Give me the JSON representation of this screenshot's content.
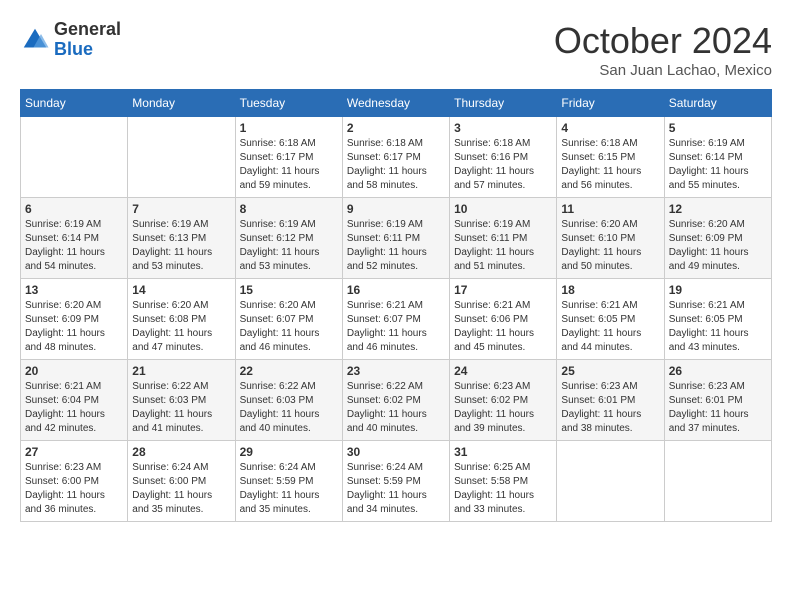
{
  "logo": {
    "general": "General",
    "blue": "Blue"
  },
  "title": "October 2024",
  "location": "San Juan Lachao, Mexico",
  "days_of_week": [
    "Sunday",
    "Monday",
    "Tuesday",
    "Wednesday",
    "Thursday",
    "Friday",
    "Saturday"
  ],
  "weeks": [
    [
      {
        "day": "",
        "info": ""
      },
      {
        "day": "",
        "info": ""
      },
      {
        "day": "1",
        "info": "Sunrise: 6:18 AM\nSunset: 6:17 PM\nDaylight: 11 hours and 59 minutes."
      },
      {
        "day": "2",
        "info": "Sunrise: 6:18 AM\nSunset: 6:17 PM\nDaylight: 11 hours and 58 minutes."
      },
      {
        "day": "3",
        "info": "Sunrise: 6:18 AM\nSunset: 6:16 PM\nDaylight: 11 hours and 57 minutes."
      },
      {
        "day": "4",
        "info": "Sunrise: 6:18 AM\nSunset: 6:15 PM\nDaylight: 11 hours and 56 minutes."
      },
      {
        "day": "5",
        "info": "Sunrise: 6:19 AM\nSunset: 6:14 PM\nDaylight: 11 hours and 55 minutes."
      }
    ],
    [
      {
        "day": "6",
        "info": "Sunrise: 6:19 AM\nSunset: 6:14 PM\nDaylight: 11 hours and 54 minutes."
      },
      {
        "day": "7",
        "info": "Sunrise: 6:19 AM\nSunset: 6:13 PM\nDaylight: 11 hours and 53 minutes."
      },
      {
        "day": "8",
        "info": "Sunrise: 6:19 AM\nSunset: 6:12 PM\nDaylight: 11 hours and 53 minutes."
      },
      {
        "day": "9",
        "info": "Sunrise: 6:19 AM\nSunset: 6:11 PM\nDaylight: 11 hours and 52 minutes."
      },
      {
        "day": "10",
        "info": "Sunrise: 6:19 AM\nSunset: 6:11 PM\nDaylight: 11 hours and 51 minutes."
      },
      {
        "day": "11",
        "info": "Sunrise: 6:20 AM\nSunset: 6:10 PM\nDaylight: 11 hours and 50 minutes."
      },
      {
        "day": "12",
        "info": "Sunrise: 6:20 AM\nSunset: 6:09 PM\nDaylight: 11 hours and 49 minutes."
      }
    ],
    [
      {
        "day": "13",
        "info": "Sunrise: 6:20 AM\nSunset: 6:09 PM\nDaylight: 11 hours and 48 minutes."
      },
      {
        "day": "14",
        "info": "Sunrise: 6:20 AM\nSunset: 6:08 PM\nDaylight: 11 hours and 47 minutes."
      },
      {
        "day": "15",
        "info": "Sunrise: 6:20 AM\nSunset: 6:07 PM\nDaylight: 11 hours and 46 minutes."
      },
      {
        "day": "16",
        "info": "Sunrise: 6:21 AM\nSunset: 6:07 PM\nDaylight: 11 hours and 46 minutes."
      },
      {
        "day": "17",
        "info": "Sunrise: 6:21 AM\nSunset: 6:06 PM\nDaylight: 11 hours and 45 minutes."
      },
      {
        "day": "18",
        "info": "Sunrise: 6:21 AM\nSunset: 6:05 PM\nDaylight: 11 hours and 44 minutes."
      },
      {
        "day": "19",
        "info": "Sunrise: 6:21 AM\nSunset: 6:05 PM\nDaylight: 11 hours and 43 minutes."
      }
    ],
    [
      {
        "day": "20",
        "info": "Sunrise: 6:21 AM\nSunset: 6:04 PM\nDaylight: 11 hours and 42 minutes."
      },
      {
        "day": "21",
        "info": "Sunrise: 6:22 AM\nSunset: 6:03 PM\nDaylight: 11 hours and 41 minutes."
      },
      {
        "day": "22",
        "info": "Sunrise: 6:22 AM\nSunset: 6:03 PM\nDaylight: 11 hours and 40 minutes."
      },
      {
        "day": "23",
        "info": "Sunrise: 6:22 AM\nSunset: 6:02 PM\nDaylight: 11 hours and 40 minutes."
      },
      {
        "day": "24",
        "info": "Sunrise: 6:23 AM\nSunset: 6:02 PM\nDaylight: 11 hours and 39 minutes."
      },
      {
        "day": "25",
        "info": "Sunrise: 6:23 AM\nSunset: 6:01 PM\nDaylight: 11 hours and 38 minutes."
      },
      {
        "day": "26",
        "info": "Sunrise: 6:23 AM\nSunset: 6:01 PM\nDaylight: 11 hours and 37 minutes."
      }
    ],
    [
      {
        "day": "27",
        "info": "Sunrise: 6:23 AM\nSunset: 6:00 PM\nDaylight: 11 hours and 36 minutes."
      },
      {
        "day": "28",
        "info": "Sunrise: 6:24 AM\nSunset: 6:00 PM\nDaylight: 11 hours and 35 minutes."
      },
      {
        "day": "29",
        "info": "Sunrise: 6:24 AM\nSunset: 5:59 PM\nDaylight: 11 hours and 35 minutes."
      },
      {
        "day": "30",
        "info": "Sunrise: 6:24 AM\nSunset: 5:59 PM\nDaylight: 11 hours and 34 minutes."
      },
      {
        "day": "31",
        "info": "Sunrise: 6:25 AM\nSunset: 5:58 PM\nDaylight: 11 hours and 33 minutes."
      },
      {
        "day": "",
        "info": ""
      },
      {
        "day": "",
        "info": ""
      }
    ]
  ]
}
